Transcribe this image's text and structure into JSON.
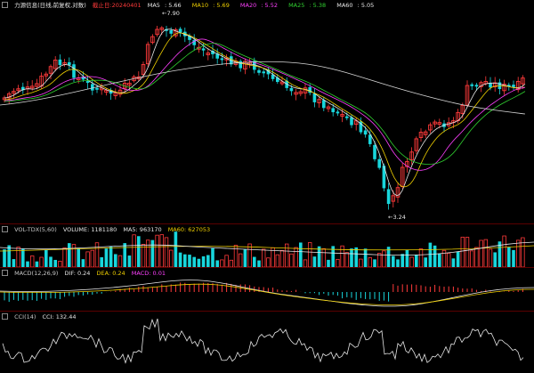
{
  "main": {
    "title": "力源信息(日线,前复权,对数)",
    "marker": "截止日:20240401",
    "ma": [
      {
        "name": "MA5",
        "value": "5.66",
        "color": "#e8e8e8"
      },
      {
        "name": "MA10",
        "value": "5.69",
        "color": "#f0d000"
      },
      {
        "name": "MA20",
        "value": "5.52",
        "color": "#ff40ff"
      },
      {
        "name": "MA25",
        "value": "5.38",
        "color": "#30d030"
      },
      {
        "name": "MA60",
        "value": "5.05",
        "color": "#e8e8e8"
      }
    ],
    "high_label": "7.90",
    "low_label": "3.24"
  },
  "vol": {
    "title": "VOL-TDX(5,60)",
    "volume": "VOLUME: 1181180",
    "ma5": "MA5: 963170",
    "ma60": "MA60: 627053"
  },
  "macd": {
    "title": "MACD(12,26,9)",
    "dif": "DIF: 0.24",
    "dea": "DEA: 0.24",
    "macd": "MACD: 0.01"
  },
  "cci": {
    "title": "CCI(14)",
    "cci": "CCI: 132.44"
  },
  "colors": {
    "up": "#ff3a3a",
    "down": "#18d6dc",
    "bg": "#000000"
  }
}
